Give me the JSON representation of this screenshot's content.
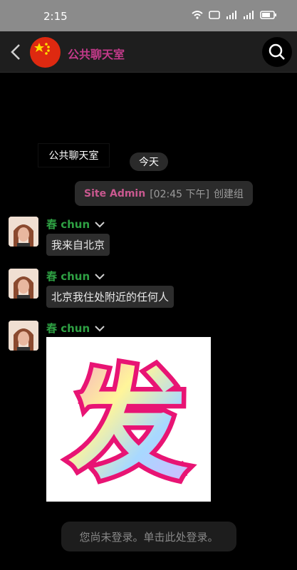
{
  "status_bar": {
    "time": "2:15"
  },
  "header": {
    "title": "公共聊天室"
  },
  "tooltip": {
    "text": "公共聊天室"
  },
  "day_divider": {
    "label": "今天"
  },
  "system_message": {
    "sender": "Site Admin",
    "time": "[02:45 下午]",
    "action": "创建组"
  },
  "messages": [
    {
      "sender": "春 chun",
      "text": "我来自北京"
    },
    {
      "sender": "春 chun",
      "text": "北京我住处附近的任何人"
    },
    {
      "sender": "春 chun",
      "image_glyph": "发"
    }
  ],
  "login_prompt": "您尚未登录。单击此处登录。",
  "colors": {
    "accent": "#c33a8a",
    "sender": "#2ea043",
    "admin": "#c9588f",
    "bubble": "#2d2d2d"
  }
}
